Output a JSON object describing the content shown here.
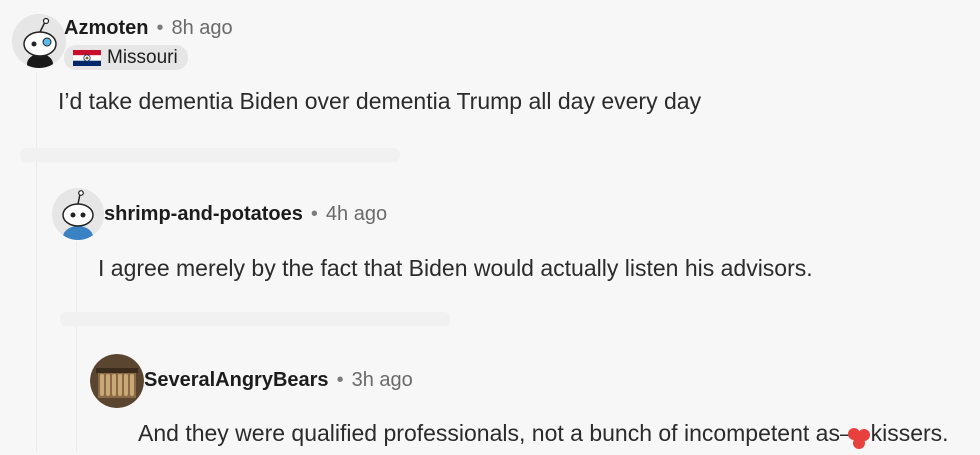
{
  "comments": [
    {
      "username": "Azmoten",
      "time": "8h ago",
      "flair": "Missouri",
      "body": "I’d take dementia Biden over dementia Trump all day every day"
    },
    {
      "username": "shrimp-and-potatoes",
      "time": "4h ago",
      "body": "I agree merely by the fact that Biden would actually listen his advisors."
    },
    {
      "username": "SeveralAngryBears",
      "time": "3h ago",
      "body": "And they were qualified professionals, not a bunch of incompetent as—-kissers."
    }
  ],
  "separator": "•",
  "colors": {
    "background": "#f7f7f7",
    "avatar_blue": "#3b82c4",
    "flag_red": "#c8102e",
    "flag_blue": "#002868",
    "censor_red": "#e8413d"
  }
}
